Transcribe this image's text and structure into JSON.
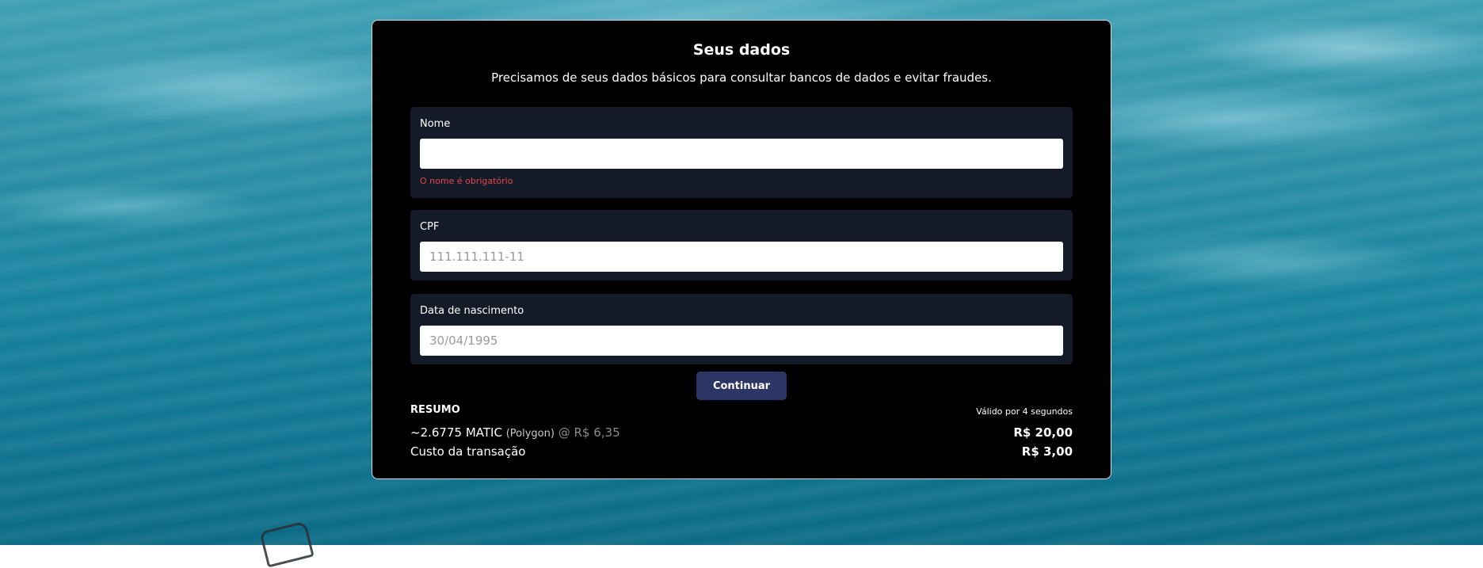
{
  "form": {
    "title": "Seus dados",
    "subtitle": "Precisamos de seus dados básicos para consultar bancos de dados e evitar fraudes.",
    "fields": [
      {
        "label": "Nome",
        "value": "",
        "placeholder": "",
        "error": "O nome é obrigatório"
      },
      {
        "label": "CPF",
        "value": "",
        "placeholder": "111.111.111-11"
      },
      {
        "label": "Data de nascimento",
        "value": "",
        "placeholder": "30/04/1995"
      }
    ],
    "submit_label": "Continuar"
  },
  "summary": {
    "title": "RESUMO",
    "validity": "Válido por 4 segundos",
    "crypto_amount": "~2.6775 MATIC",
    "network": "(Polygon)",
    "rate": "@ R$ 6,35",
    "total": "R$ 20,00",
    "fee_label": "Custo da transação",
    "fee_value": "R$ 3,00"
  },
  "colors": {
    "card_bg": "#000000",
    "field_bg": "#151a28",
    "button_bg": "#2b3566",
    "error": "#e04848"
  }
}
